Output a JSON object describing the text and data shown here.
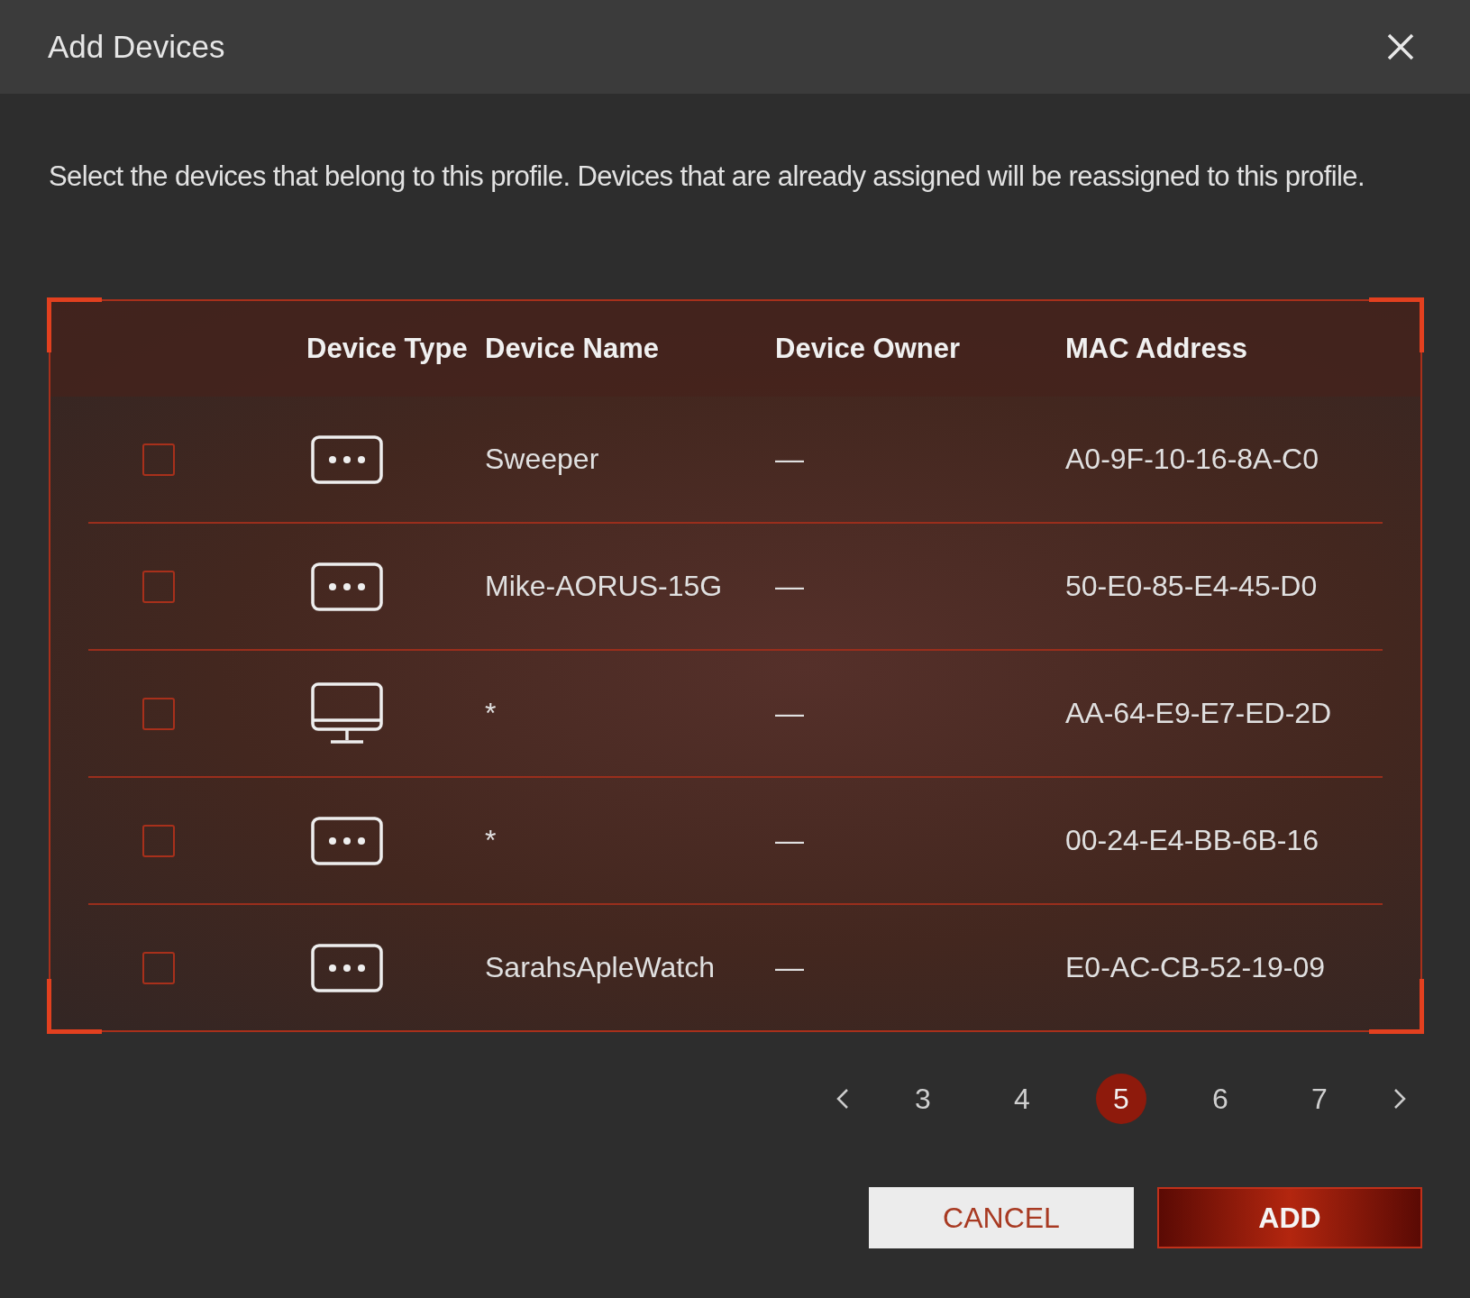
{
  "dialog": {
    "title": "Add Devices"
  },
  "description": "Select the devices that belong to this profile. Devices that are already assigned will be reassigned to this profile.",
  "table": {
    "columns": [
      "Device Type",
      "Device Name",
      "Device Owner",
      "MAC Address"
    ],
    "rows": [
      {
        "checked": false,
        "kind": "other",
        "name": "Sweeper",
        "owner": "—",
        "mac": "A0-9F-10-16-8A-C0"
      },
      {
        "checked": false,
        "kind": "other",
        "name": "Mike-AORUS-15G",
        "owner": "—",
        "mac": "50-E0-85-E4-45-D0"
      },
      {
        "checked": false,
        "kind": "desktop",
        "name": "*",
        "owner": "—",
        "mac": "AA-64-E9-E7-ED-2D"
      },
      {
        "checked": false,
        "kind": "other",
        "name": "*",
        "owner": "—",
        "mac": "00-24-E4-BB-6B-16"
      },
      {
        "checked": false,
        "kind": "other",
        "name": "SarahsApleWatch",
        "owner": "—",
        "mac": "E0-AC-CB-52-19-09"
      }
    ]
  },
  "pagination": {
    "pages": [
      {
        "label": "3",
        "selected": false
      },
      {
        "label": "4",
        "selected": false
      },
      {
        "label": "5",
        "selected": true
      },
      {
        "label": "6",
        "selected": false
      },
      {
        "label": "7",
        "selected": false
      }
    ]
  },
  "buttons": [
    {
      "label": "CANCEL",
      "kind": "secondary"
    },
    {
      "label": "ADD",
      "kind": "primary"
    }
  ]
}
